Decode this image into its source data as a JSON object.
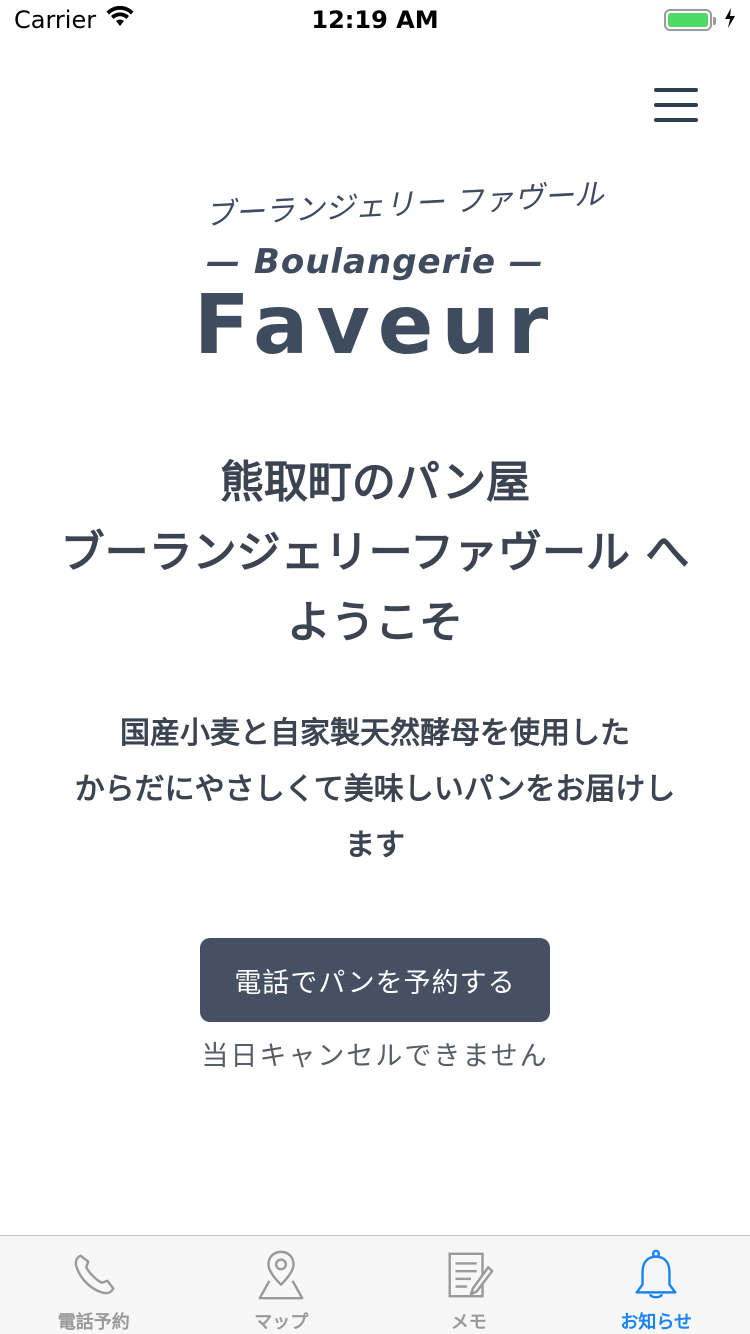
{
  "status_bar": {
    "carrier": "Carrier",
    "time": "12:19 AM"
  },
  "logo": {
    "kana": "ブーランジェリー ファヴール",
    "subtitle": "— Boulangerie —",
    "name": "Faveur"
  },
  "headline": {
    "lines": [
      "熊取町のパン屋",
      "ブーランジェリーファヴール へ",
      "ようこそ"
    ]
  },
  "description": {
    "lines": [
      "国産小麦と自家製天然酵母を使用した",
      "からだにやさしくて美味しいパンをお届けし",
      "ます"
    ]
  },
  "cta": {
    "label": "電話でパンを予約する",
    "note": "当日キャンセルできません"
  },
  "tabs": [
    {
      "label": "電話予約",
      "icon": "phone-icon",
      "active": false
    },
    {
      "label": "マップ",
      "icon": "map-pin-icon",
      "active": false
    },
    {
      "label": "メモ",
      "icon": "memo-icon",
      "active": false
    },
    {
      "label": "お知らせ",
      "icon": "bell-icon",
      "active": true
    }
  ],
  "colors": {
    "brand": "#3f4b5f",
    "button": "#455062",
    "tab_active": "#1a84f0",
    "tab_inactive": "#9a9a9a",
    "battery": "#4cd964"
  }
}
